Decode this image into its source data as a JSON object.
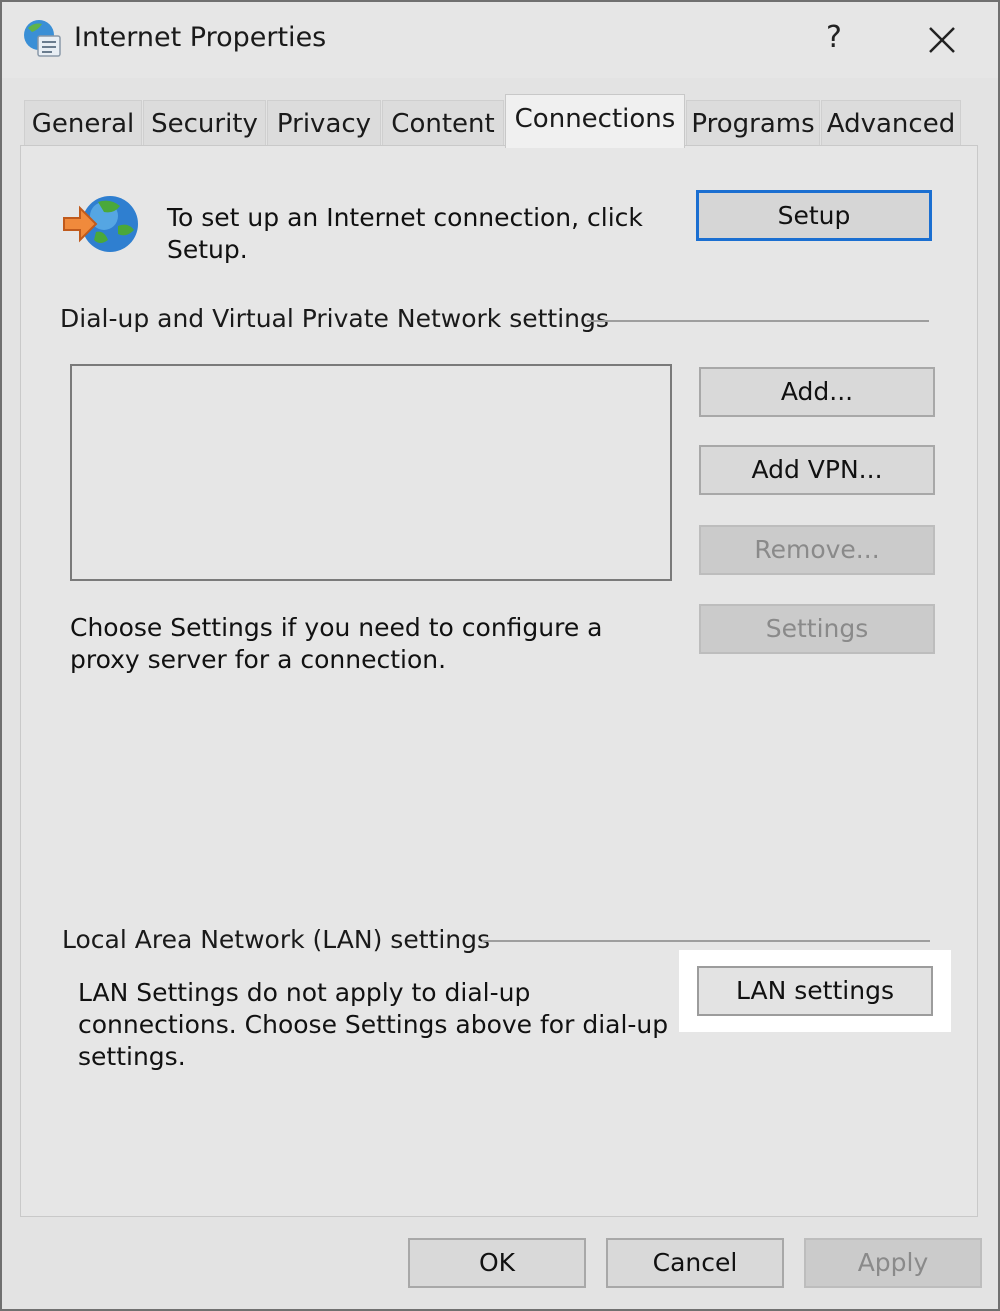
{
  "window": {
    "title": "Internet Properties",
    "help_label": "?",
    "icons": {
      "app": "internet-options-icon",
      "close": "close-icon",
      "connection": "globe-arrow-icon"
    }
  },
  "tabs": [
    {
      "label": "General",
      "active": false
    },
    {
      "label": "Security",
      "active": false
    },
    {
      "label": "Privacy",
      "active": false
    },
    {
      "label": "Content",
      "active": false
    },
    {
      "label": "Connections",
      "active": true
    },
    {
      "label": "Programs",
      "active": false
    },
    {
      "label": "Advanced",
      "active": false
    }
  ],
  "connections": {
    "setup_text": "To set up an Internet connection, click Setup.",
    "setup_button": "Setup",
    "dialup_group_label": "Dial-up and Virtual Private Network settings",
    "dialup_list_items": [],
    "add_button": "Add...",
    "add_vpn_button": "Add VPN...",
    "remove_button": "Remove...",
    "settings_button": "Settings",
    "proxy_text": "Choose Settings if you need to configure a proxy server for a connection.",
    "lan_group_label": "Local Area Network (LAN) settings",
    "lan_text": "LAN Settings do not apply to dial-up connections. Choose Settings above for dial-up settings.",
    "lan_settings_button": "LAN settings"
  },
  "footer": {
    "ok_button": "OK",
    "cancel_button": "Cancel",
    "apply_button": "Apply"
  },
  "colors": {
    "focus_border": "#1b6fd1",
    "disabled_text": "#8a8a8a",
    "highlight": "#ffffff"
  }
}
